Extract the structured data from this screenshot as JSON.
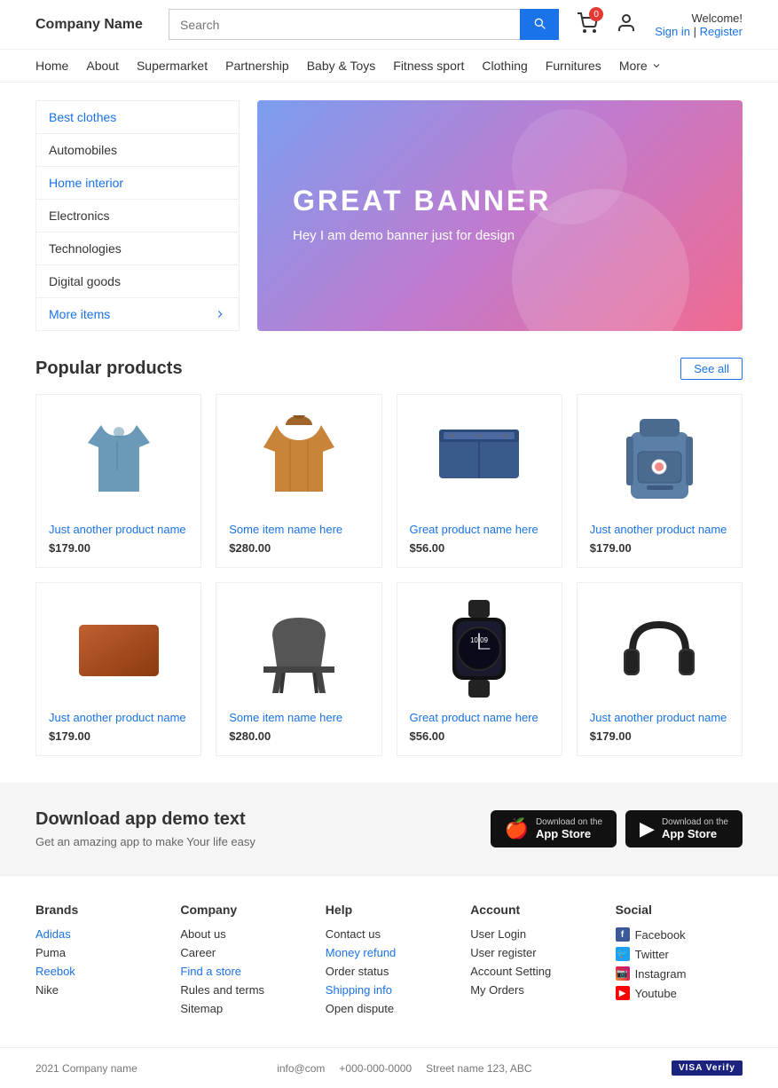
{
  "header": {
    "logo": "Company Name",
    "search_placeholder": "Search",
    "cart_badge": "0",
    "welcome": "Welcome!",
    "sign_in": "Sign in",
    "separator": "|",
    "register": "Register"
  },
  "navbar": {
    "items": [
      {
        "label": "Home",
        "href": "#"
      },
      {
        "label": "About",
        "href": "#"
      },
      {
        "label": "Supermarket",
        "href": "#"
      },
      {
        "label": "Partnership",
        "href": "#"
      },
      {
        "label": "Baby &amp; Toys",
        "href": "#"
      },
      {
        "label": "Fitness sport",
        "href": "#"
      },
      {
        "label": "Clothing",
        "href": "#"
      },
      {
        "label": "Furnitures",
        "href": "#"
      },
      {
        "label": "More",
        "href": "#"
      }
    ]
  },
  "sidebar": {
    "items": [
      {
        "label": "Best clothes",
        "link": true
      },
      {
        "label": "Automobiles",
        "link": false
      },
      {
        "label": "Home interior",
        "link": true
      },
      {
        "label": "Electronics",
        "link": false
      },
      {
        "label": "Technologies",
        "link": false
      },
      {
        "label": "Digital goods",
        "link": false
      },
      {
        "label": "More items",
        "link": true,
        "arrow": true
      }
    ]
  },
  "banner": {
    "title": "GREAT BANNER",
    "subtitle": "Hey I am demo banner just for design"
  },
  "popular_products": {
    "title": "Popular products",
    "see_all": "See all",
    "products": [
      {
        "name": "Just another product name",
        "price": "$179.00",
        "color": "#6b9ab8",
        "type": "shirt"
      },
      {
        "name": "Some item name here",
        "price": "$280.00",
        "color": "#c8853a",
        "type": "jacket"
      },
      {
        "name": "Great product name here",
        "price": "$56.00",
        "color": "#3a5a8c",
        "type": "shorts"
      },
      {
        "name": "Just another product name",
        "price": "$179.00",
        "color": "#5b7fa6",
        "type": "backpack"
      },
      {
        "name": "Just another product name",
        "price": "$179.00",
        "color": "#a0522d",
        "type": "laptop"
      },
      {
        "name": "Some item name here",
        "price": "$280.00",
        "color": "#555",
        "type": "chair"
      },
      {
        "name": "Great product name here",
        "price": "$56.00",
        "color": "#222",
        "type": "watch"
      },
      {
        "name": "Just another product name",
        "price": "$179.00",
        "color": "#333",
        "type": "headphones"
      }
    ]
  },
  "download": {
    "title": "Download app demo text",
    "subtitle": "Get an amazing app to make Your life easy",
    "appstore_small": "Download on the",
    "appstore_big": "App Store",
    "playstore_small": "Download on the",
    "playstore_big": "App Store"
  },
  "footer": {
    "brands": {
      "title": "Brands",
      "items": [
        {
          "label": "Adidas",
          "blue": true
        },
        {
          "label": "Puma",
          "blue": false
        },
        {
          "label": "Reebok",
          "blue": true
        },
        {
          "label": "Nike",
          "blue": false
        }
      ]
    },
    "company": {
      "title": "Company",
      "items": [
        {
          "label": "About us",
          "blue": false
        },
        {
          "label": "Career",
          "blue": false
        },
        {
          "label": "Find a store",
          "blue": true
        },
        {
          "label": "Rules and terms",
          "blue": false
        },
        {
          "label": "Sitemap",
          "blue": false
        }
      ]
    },
    "help": {
      "title": "Help",
      "items": [
        {
          "label": "Contact us",
          "blue": false
        },
        {
          "label": "Money refund",
          "blue": true
        },
        {
          "label": "Order status",
          "blue": false
        },
        {
          "label": "Shipping info",
          "blue": true
        },
        {
          "label": "Open dispute",
          "blue": false
        }
      ]
    },
    "account": {
      "title": "Account",
      "items": [
        {
          "label": "User Login",
          "blue": false
        },
        {
          "label": "User register",
          "blue": false
        },
        {
          "label": "Account Setting",
          "blue": false
        },
        {
          "label": "My Orders",
          "blue": false
        }
      ]
    },
    "social": {
      "title": "Social",
      "items": [
        {
          "label": "Facebook",
          "icon": "f"
        },
        {
          "label": "Twitter",
          "icon": "t"
        },
        {
          "label": "Instagram",
          "icon": "i"
        },
        {
          "label": "Youtube",
          "icon": "y"
        }
      ]
    },
    "bottom": {
      "copy": "2021 Company name",
      "email": "info@com",
      "phone": "+000-000-0000",
      "address": "Street name 123, ABC",
      "visa": "VISA Verify"
    }
  }
}
